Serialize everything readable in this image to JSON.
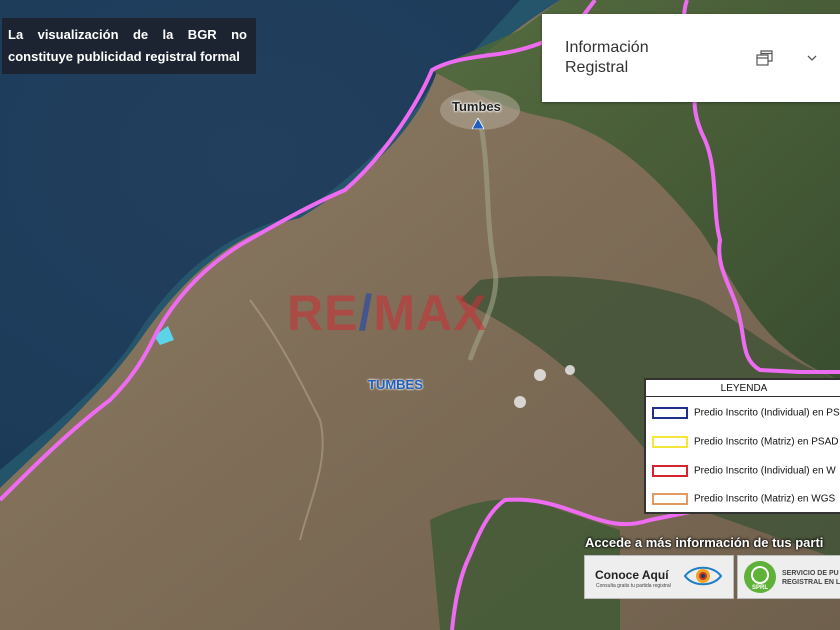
{
  "disclaimer": "La visualización de la BGR no constituye publicidad registral formal",
  "info_panel": {
    "title": "Información Registral",
    "restore_icon": "restore-window-icon",
    "collapse_icon": "chevron-down-icon"
  },
  "map": {
    "basemap": "satellite-imagery",
    "boundary_color": "#ee6cf2",
    "city_label": "Tumbes",
    "region_label": "TUMBES",
    "watermark": {
      "left": "RE",
      "slash": "/",
      "right": "MAX"
    }
  },
  "legend": {
    "title": "LEYENDA",
    "items": [
      {
        "label": "Predio Inscrito (Individual) en PS",
        "color": "#1f2f8a"
      },
      {
        "label": "Predio Inscrito (Matriz) en PSAD",
        "color": "#f2e63a"
      },
      {
        "label": "Predio Inscrito (Individual) en W",
        "color": "#d3252f"
      },
      {
        "label": "Predio Inscrito (Matriz) en WGS",
        "color": "#e39a62"
      }
    ]
  },
  "promo": {
    "title": "Accede a más información de tus parti",
    "conoce_main": "Conoce Aquí",
    "conoce_sub": "Consulta gratis tu partida registral",
    "sprl_line1": "SERVICIO DE PU",
    "sprl_line2": "REGISTRAL EN L",
    "sprl_logo_text": "SPRL"
  }
}
